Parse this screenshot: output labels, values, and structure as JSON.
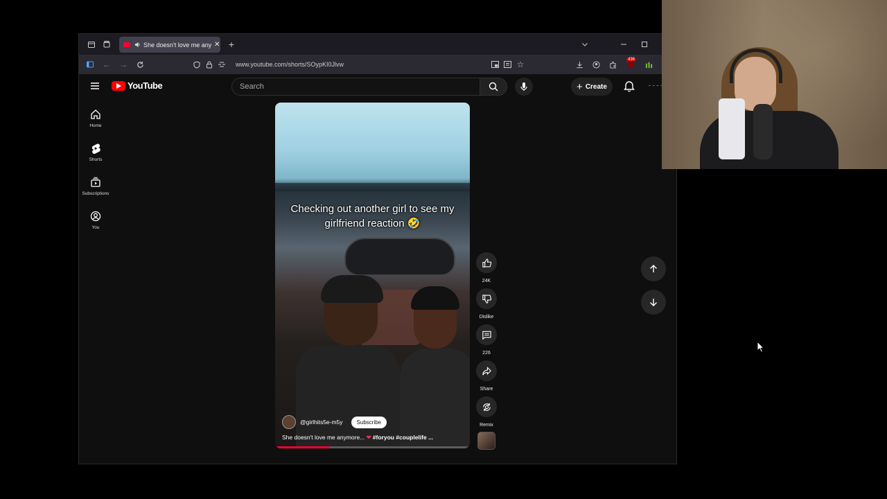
{
  "browser": {
    "tab_title": "She doesn't love me anymo",
    "url": "www.youtube.com/shorts/SOypKI0Jlvw",
    "extension_badge": "436"
  },
  "youtube": {
    "logo_text": "YouTube",
    "search_placeholder": "Search",
    "create_label": "Create",
    "sidebar": [
      {
        "label": "Home",
        "icon": "home-icon"
      },
      {
        "label": "Shorts",
        "icon": "shorts-icon"
      },
      {
        "label": "Subscriptions",
        "icon": "subscriptions-icon"
      },
      {
        "label": "You",
        "icon": "you-icon"
      }
    ]
  },
  "short": {
    "caption": "Checking out another girl to see my girlfriend reaction 🤣",
    "channel": "@girlhits5e-m5y",
    "subscribe_label": "Subscribe",
    "description_text": "She doesn't love me anymore...",
    "description_tags": "#foryou #couplelife ...",
    "progress": 0.28
  },
  "actions": {
    "likes": "24K",
    "dislike_label": "Dislike",
    "comments": "226",
    "share_label": "Share",
    "remix_label": "Remix"
  },
  "colors": {
    "accent": "#ff0033",
    "background": "#0f0f0f",
    "button_bg": "#272727"
  }
}
